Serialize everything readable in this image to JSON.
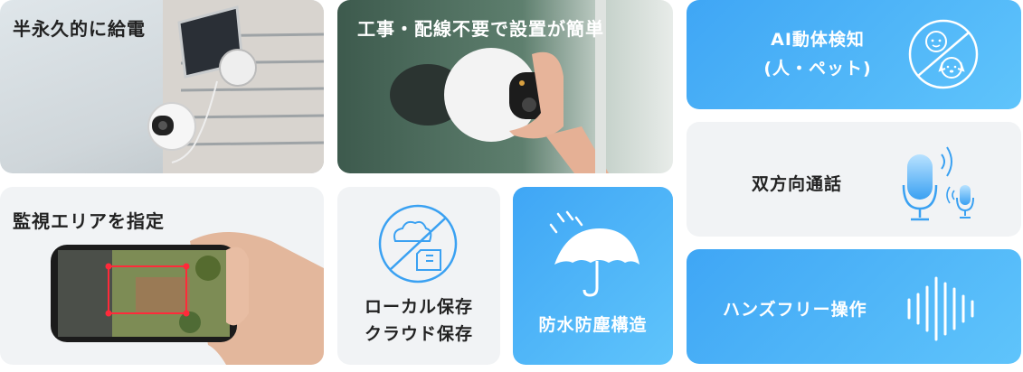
{
  "cards": {
    "solar": {
      "title": "半永久的に給電"
    },
    "install": {
      "title": "工事・配線不要で設置が簡単"
    },
    "ai": {
      "line1": "AI動体検知",
      "line2": "(人・ペット)"
    },
    "talk": {
      "title": "双方向通話"
    },
    "handsfree": {
      "title": "ハンズフリー操作"
    },
    "zone": {
      "title": "監視エリアを指定"
    },
    "storage": {
      "line1": "ローカル保存",
      "line2": "クラウド保存"
    },
    "waterproof": {
      "title": "防水防塵構造"
    }
  },
  "colors": {
    "blue": "#3fa6f5",
    "blue_light": "#5fc4fb",
    "gray": "#f1f3f5",
    "dark_text": "#222222",
    "white": "#ffffff"
  },
  "icons": [
    "sun-panel",
    "camera",
    "face-icon",
    "dog-icon",
    "microphone-icon",
    "sound-wave-icon",
    "cloud-icon",
    "sd-card-icon",
    "umbrella-icon",
    "smartphone"
  ]
}
